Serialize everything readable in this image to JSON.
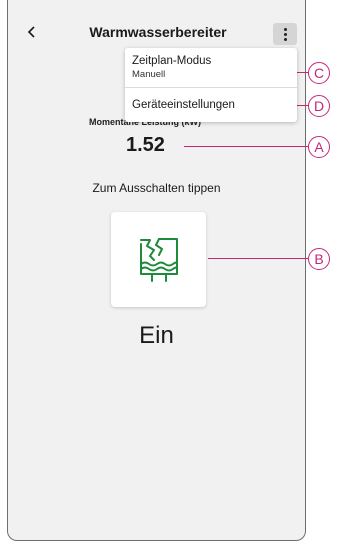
{
  "header": {
    "title": "Warmwasserbereiter",
    "back_icon": "chevron-left-icon",
    "menu_icon": "more-vertical-icon"
  },
  "menu": {
    "items": [
      {
        "label": "Zeitplan-Modus",
        "value": "Manuell"
      },
      {
        "label": "Geräteeinstellungen"
      }
    ]
  },
  "main": {
    "power_label": "Momentane Leistung (kW)",
    "power_value": "1.52",
    "hint": "Zum Ausschalten tippen",
    "device_icon": "water-heater-icon",
    "state": "Ein"
  },
  "callouts": [
    "A",
    "B",
    "C",
    "D"
  ],
  "colors": {
    "accent": "#c4267a",
    "icon_green": "#1f8a3a",
    "background": "#f1f1f1"
  }
}
